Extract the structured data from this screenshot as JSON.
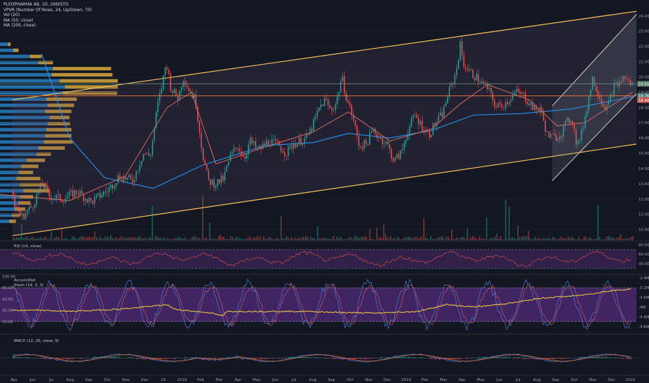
{
  "header": {
    "symbol": "PLEOPHARMA AB, 1D, OMXSTO",
    "indicators": [
      "VPVR (Number Of Rows, 24, Up/Down, 70)",
      "Vol (20)",
      "MA (50, close)",
      "MA (200, close)"
    ]
  },
  "panes": {
    "rsi_label": "RSI (14, close)",
    "accum_label": "Accum/Dist",
    "stoch_label": "Stoch (14, 3, 3)",
    "macd_label": "MACD (12, 26, close, 9)"
  },
  "colors": {
    "up": "#26a69a",
    "down": "#ef5350",
    "ma50": "#e57368",
    "ma200": "#2196f3",
    "channel": "#f6c35b",
    "vp_up": "#2b8cd6",
    "vp_down": "#e4b03c",
    "rsi": "#c0474f",
    "band": "#4a2a6a",
    "stoch_k": "#4e7bd6",
    "stoch_d": "#c45a6a",
    "accum": "#f5d33a"
  },
  "chart_data": [
    {
      "type": "candlestick",
      "pane": "price",
      "y_axis_ticks": [
        "24.00",
        "23.00",
        "22.00",
        "21.00",
        "20.00",
        "19.00",
        "18.00",
        "17.00",
        "16.00",
        "15.00",
        "14.00",
        "13.00",
        "12.00",
        "11.00",
        "10.00"
      ],
      "ylim": [
        9.3,
        24.4
      ],
      "x_ticks": [
        "Apr",
        "Jun",
        "Jul",
        "Aug",
        "Sep",
        "Oct",
        "Nov",
        "Dec",
        "29",
        "2018",
        "Feb",
        "Mar",
        "Apr",
        "May",
        "Jun",
        "Jul",
        "Aug",
        "Sep",
        "Oct",
        "Nov",
        "Dec",
        "2019",
        "Feb",
        "Mar",
        "Apr",
        "May",
        "Jun",
        "Jul",
        "Aug",
        "Sep",
        "Oct",
        "Nov",
        "Dec",
        "2020"
      ],
      "price_labels": [
        "19.55",
        "18.76",
        "18.48"
      ],
      "anchors": [
        [
          0,
          12.5
        ],
        [
          15,
          12.2
        ],
        [
          30,
          10.8
        ],
        [
          45,
          11.5
        ],
        [
          60,
          13.0
        ],
        [
          70,
          12.2
        ],
        [
          90,
          12.0
        ],
        [
          110,
          12.5
        ],
        [
          130,
          11.8
        ],
        [
          145,
          12.3
        ],
        [
          155,
          12.6
        ],
        [
          170,
          13.5
        ],
        [
          190,
          13.2
        ],
        [
          205,
          15.0
        ],
        [
          215,
          14.8
        ],
        [
          225,
          18.0
        ],
        [
          232,
          19.5
        ],
        [
          238,
          21.0
        ],
        [
          245,
          19.2
        ],
        [
          255,
          18.6
        ],
        [
          262,
          20.0
        ],
        [
          270,
          19.2
        ],
        [
          280,
          18.5
        ],
        [
          290,
          15.0
        ],
        [
          298,
          13.2
        ],
        [
          308,
          13.0
        ],
        [
          320,
          13.3
        ],
        [
          330,
          14.8
        ],
        [
          340,
          15.5
        ],
        [
          350,
          14.7
        ],
        [
          358,
          15.8
        ],
        [
          370,
          15.2
        ],
        [
          385,
          15.8
        ],
        [
          400,
          15.5
        ],
        [
          410,
          15.0
        ],
        [
          420,
          15.6
        ],
        [
          430,
          15.8
        ],
        [
          440,
          16.0
        ],
        [
          450,
          17.0
        ],
        [
          458,
          18.0
        ],
        [
          466,
          18.5
        ],
        [
          474,
          17.8
        ],
        [
          482,
          18.3
        ],
        [
          490,
          20.0
        ],
        [
          497,
          18.6
        ],
        [
          505,
          17.5
        ],
        [
          515,
          15.5
        ],
        [
          525,
          15.6
        ],
        [
          535,
          16.5
        ],
        [
          545,
          16.0
        ],
        [
          555,
          15.6
        ],
        [
          565,
          14.5
        ],
        [
          575,
          15.0
        ],
        [
          585,
          16.5
        ],
        [
          595,
          17.5
        ],
        [
          605,
          16.8
        ],
        [
          615,
          16.2
        ],
        [
          625,
          17.0
        ],
        [
          635,
          17.6
        ],
        [
          642,
          18.8
        ],
        [
          648,
          19.5
        ],
        [
          654,
          20.3
        ],
        [
          660,
          22.1
        ],
        [
          666,
          20.7
        ],
        [
          675,
          20.3
        ],
        [
          685,
          19.9
        ],
        [
          700,
          19.2
        ],
        [
          712,
          18.0
        ],
        [
          725,
          18.3
        ],
        [
          740,
          19.0
        ],
        [
          750,
          18.8
        ],
        [
          760,
          18.3
        ],
        [
          768,
          17.8
        ],
        [
          775,
          18.0
        ],
        [
          785,
          16.2
        ],
        [
          795,
          16.0
        ],
        [
          805,
          16.3
        ],
        [
          812,
          16.9
        ],
        [
          820,
          17.4
        ],
        [
          828,
          15.5
        ],
        [
          835,
          16.4
        ],
        [
          842,
          18.0
        ],
        [
          850,
          19.9
        ],
        [
          858,
          19.0
        ],
        [
          865,
          18.2
        ],
        [
          872,
          18.0
        ],
        [
          880,
          19.3
        ],
        [
          888,
          19.6
        ],
        [
          896,
          20.0
        ],
        [
          903,
          19.6
        ],
        [
          908,
          19.5
        ]
      ],
      "ma50": [
        [
          0,
          12.3
        ],
        [
          100,
          11.9
        ],
        [
          180,
          13.5
        ],
        [
          240,
          18.0
        ],
        [
          275,
          19.0
        ],
        [
          310,
          14.3
        ],
        [
          380,
          15.4
        ],
        [
          450,
          16.4
        ],
        [
          500,
          17.7
        ],
        [
          560,
          15.8
        ],
        [
          620,
          16.6
        ],
        [
          660,
          18.2
        ],
        [
          700,
          19.5
        ],
        [
          760,
          18.5
        ],
        [
          800,
          16.8
        ],
        [
          840,
          17.0
        ],
        [
          908,
          19.0
        ]
      ],
      "ma200": [
        [
          60,
          21.5
        ],
        [
          100,
          16.0
        ],
        [
          150,
          13.4
        ],
        [
          220,
          12.7
        ],
        [
          290,
          14.2
        ],
        [
          380,
          15.5
        ],
        [
          450,
          15.7
        ],
        [
          500,
          16.3
        ],
        [
          560,
          16.0
        ],
        [
          620,
          16.5
        ],
        [
          680,
          17.5
        ],
        [
          750,
          17.6
        ],
        [
          820,
          17.9
        ],
        [
          908,
          18.7
        ]
      ],
      "channel_upper": [
        [
          18,
          18.5
        ],
        [
          914,
          24.3
        ]
      ],
      "channel_lower": [
        [
          18,
          9.6
        ],
        [
          914,
          15.6
        ]
      ],
      "channel_inner_top": [
        [
          793,
          18.1
        ],
        [
          914,
          24.1
        ]
      ],
      "channel_inner_bottom": [
        [
          793,
          13.2
        ],
        [
          914,
          18.9
        ]
      ],
      "hlines": [
        19.55,
        18.76
      ],
      "volume_profile": [
        {
          "price": 22.0,
          "up": 12,
          "down": 4
        },
        {
          "price": 21.6,
          "up": 20,
          "down": 8
        },
        {
          "price": 21.2,
          "up": 45,
          "down": 18
        },
        {
          "price": 20.8,
          "up": 58,
          "down": 22
        },
        {
          "price": 20.4,
          "up": 80,
          "down": 88
        },
        {
          "price": 20.0,
          "up": 78,
          "down": 92
        },
        {
          "price": 19.6,
          "up": 90,
          "down": 88
        },
        {
          "price": 19.2,
          "up": 98,
          "down": 80
        },
        {
          "price": 18.8,
          "up": 95,
          "down": 82
        },
        {
          "price": 18.4,
          "up": 70,
          "down": 46
        },
        {
          "price": 18.0,
          "up": 72,
          "down": 40
        },
        {
          "price": 17.6,
          "up": 68,
          "down": 40
        },
        {
          "price": 17.2,
          "up": 75,
          "down": 30
        },
        {
          "price": 16.8,
          "up": 72,
          "down": 34
        },
        {
          "price": 16.4,
          "up": 70,
          "down": 38
        },
        {
          "price": 16.0,
          "up": 68,
          "down": 40
        },
        {
          "price": 15.6,
          "up": 66,
          "down": 44
        },
        {
          "price": 15.2,
          "up": 58,
          "down": 40
        },
        {
          "price": 14.8,
          "up": 55,
          "down": 22
        },
        {
          "price": 14.4,
          "up": 40,
          "down": 28
        },
        {
          "price": 14.0,
          "up": 32,
          "down": 26
        },
        {
          "price": 13.6,
          "up": 28,
          "down": 22
        },
        {
          "price": 13.2,
          "up": 25,
          "down": 36
        },
        {
          "price": 12.8,
          "up": 30,
          "down": 40
        },
        {
          "price": 12.4,
          "up": 35,
          "down": 40
        },
        {
          "price": 12.0,
          "up": 30,
          "down": 20
        },
        {
          "price": 11.6,
          "up": 28,
          "down": 18
        },
        {
          "price": 11.2,
          "up": 22,
          "down": 16
        },
        {
          "price": 10.8,
          "up": 18,
          "down": 12
        },
        {
          "price": 10.4,
          "up": 14,
          "down": 10
        }
      ]
    },
    {
      "type": "line",
      "pane": "rsi",
      "name": "RSI (14, close)",
      "ylim": [
        20,
        85
      ],
      "y_axis_ticks": [
        "80.00",
        "60.00",
        "40.00"
      ],
      "band": [
        30,
        70
      ]
    },
    {
      "type": "line",
      "pane": "stoch_accum",
      "ylim": [
        0,
        100
      ],
      "y_axis_ticks_left": [
        "100.00",
        "80.00",
        "60.00",
        "40.00",
        "20.00"
      ],
      "y_axis_ticks_right": [
        "-2.4M",
        "-3.2M",
        "-3.6M",
        "-4M",
        "-4.4M",
        "-4.8M"
      ],
      "band": [
        20,
        80
      ],
      "accum_dist_steps": [
        [
          0,
          40
        ],
        [
          60,
          40
        ],
        [
          100,
          38
        ],
        [
          170,
          42
        ],
        [
          200,
          45
        ],
        [
          240,
          50
        ],
        [
          250,
          42
        ],
        [
          280,
          38
        ],
        [
          300,
          36
        ],
        [
          320,
          30
        ],
        [
          326,
          38
        ],
        [
          380,
          38
        ],
        [
          440,
          38
        ],
        [
          500,
          36
        ],
        [
          540,
          35
        ],
        [
          600,
          38
        ],
        [
          640,
          50
        ],
        [
          680,
          46
        ],
        [
          700,
          48
        ],
        [
          740,
          54
        ],
        [
          780,
          62
        ],
        [
          830,
          66
        ],
        [
          880,
          75
        ],
        [
          908,
          78
        ]
      ]
    },
    {
      "type": "line",
      "pane": "macd",
      "name": "MACD (12, 26, close, 9)"
    }
  ]
}
